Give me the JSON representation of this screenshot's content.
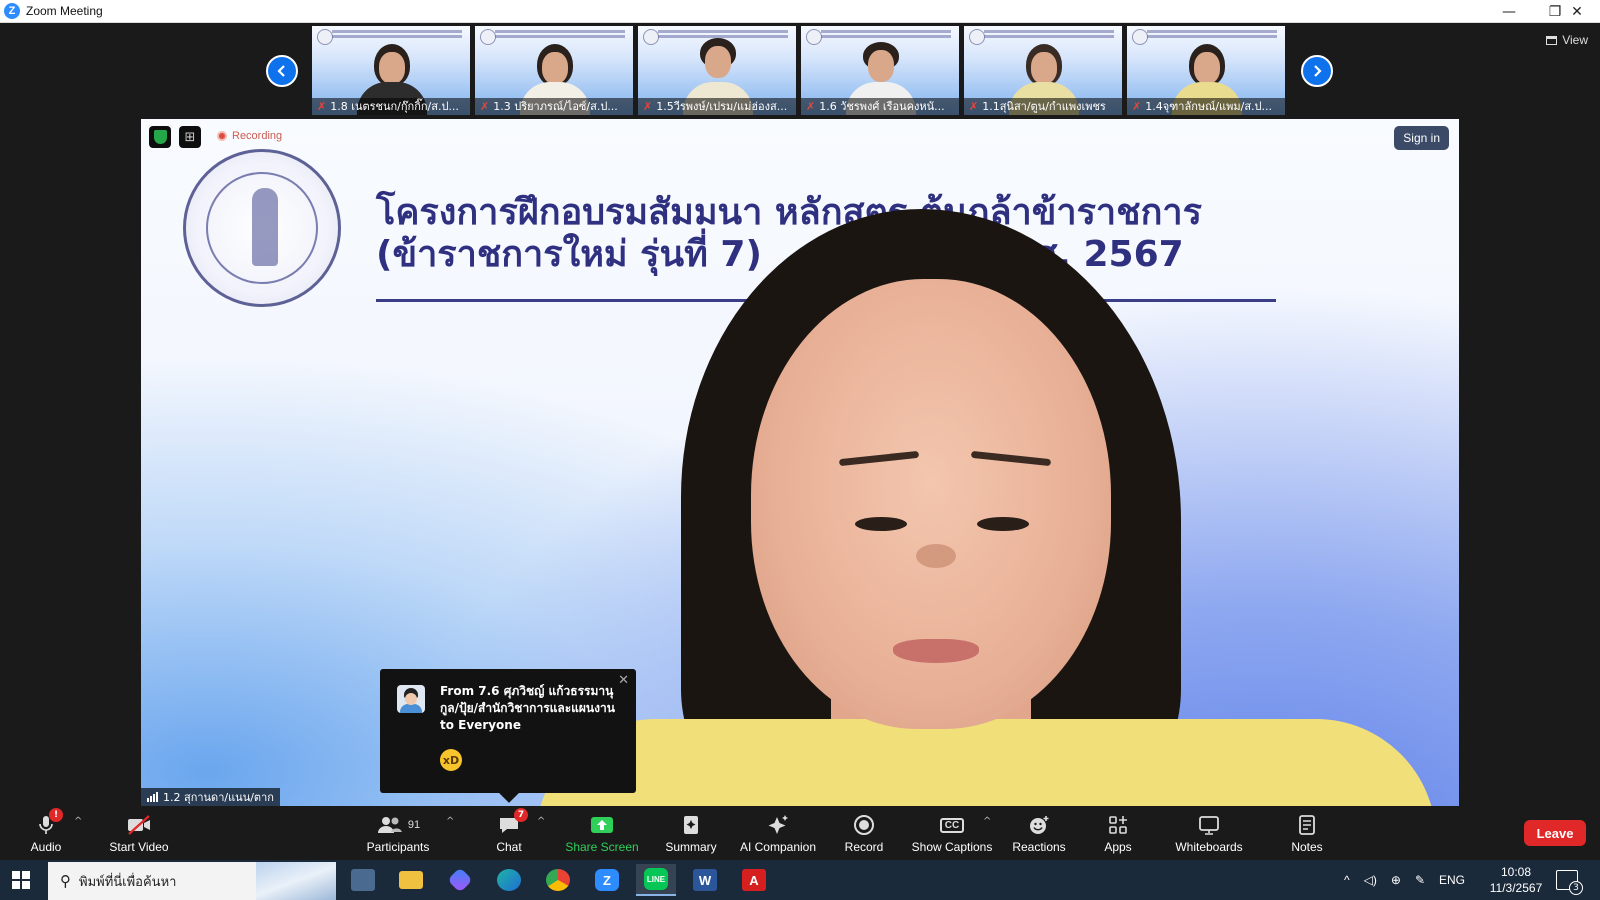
{
  "window": {
    "title": "Zoom Meeting",
    "logo_letter": "Z",
    "minimize_glyph": "—",
    "restore_glyph": "❐",
    "close_glyph": "✕"
  },
  "gallery": {
    "prev_icon": "chevron-left-icon",
    "next_icon": "chevron-right-icon",
    "view_label": "View",
    "participants": [
      {
        "name": "1.8 เนตรชนก/กุ๊กกิ๊ก/ส.ป...",
        "muted": true
      },
      {
        "name": "1.3 ปริยาภรณ์/ไอซ์/ส.ป...",
        "muted": true
      },
      {
        "name": "1.5วีรพงษ์/เปรม/แม่ฮ่องส...",
        "muted": true
      },
      {
        "name": "1.6 วัชรพงศ์ เรือนคงหนั...",
        "muted": true
      },
      {
        "name": "1.1สุนิสา/ตูน/กำแพงเพชร",
        "muted": true
      },
      {
        "name": "1.4จุฑาลักษณ์/แพม/ส.ป...",
        "muted": true
      }
    ]
  },
  "main_video": {
    "recording_label": "Recording",
    "sign_in_label": "Sign in",
    "speaker_name": "1.2 สุกานดา/แนน/ตาก",
    "slide_title_line1": "โครงการฝึกอบรมสัมมนา หลักสูตร ต้นกล้าข้าราชการ",
    "slide_title_line2_part1": "(ข้าราชการใหม่ รุ่นที่ 7)",
    "slide_title_line2_part2": "พ.ศ. 2567"
  },
  "chat_notification": {
    "from_text": "From 7.6 ศุภวิชญ์ แก้วธรรมานุกูล/ปุ้ย/สำนักวิชาการและแผนงาน to Everyone",
    "message_emoji": "laughing-face-emoji",
    "close_glyph": "✕"
  },
  "toolbar": {
    "audio": {
      "label": "Audio",
      "badge": "!"
    },
    "video": {
      "label": "Start Video"
    },
    "participants": {
      "label": "Participants",
      "count": "91"
    },
    "chat": {
      "label": "Chat",
      "badge": "7"
    },
    "share": {
      "label": "Share Screen"
    },
    "summary": {
      "label": "Summary"
    },
    "ai": {
      "label": "AI Companion"
    },
    "record": {
      "label": "Record"
    },
    "captions": {
      "label": "Show Captions",
      "icon_text": "CC"
    },
    "reactions": {
      "label": "Reactions"
    },
    "apps": {
      "label": "Apps"
    },
    "whiteboards": {
      "label": "Whiteboards"
    },
    "notes": {
      "label": "Notes"
    },
    "leave": {
      "label": "Leave"
    }
  },
  "taskbar": {
    "search_placeholder": "พิมพ์ที่นี่เพื่อค้นหา",
    "apps": [
      "task-view",
      "file-explorer",
      "copilot",
      "edge",
      "chrome",
      "zoom",
      "line",
      "word",
      "acrobat"
    ],
    "language": "ENG",
    "time": "10:08",
    "date": "11/3/2567",
    "notifications_count": "3"
  },
  "colors": {
    "zoom_blue": "#0e72ed",
    "share_green": "#2fd05a",
    "leave_red": "#e02828",
    "slide_text": "#2f3180"
  }
}
